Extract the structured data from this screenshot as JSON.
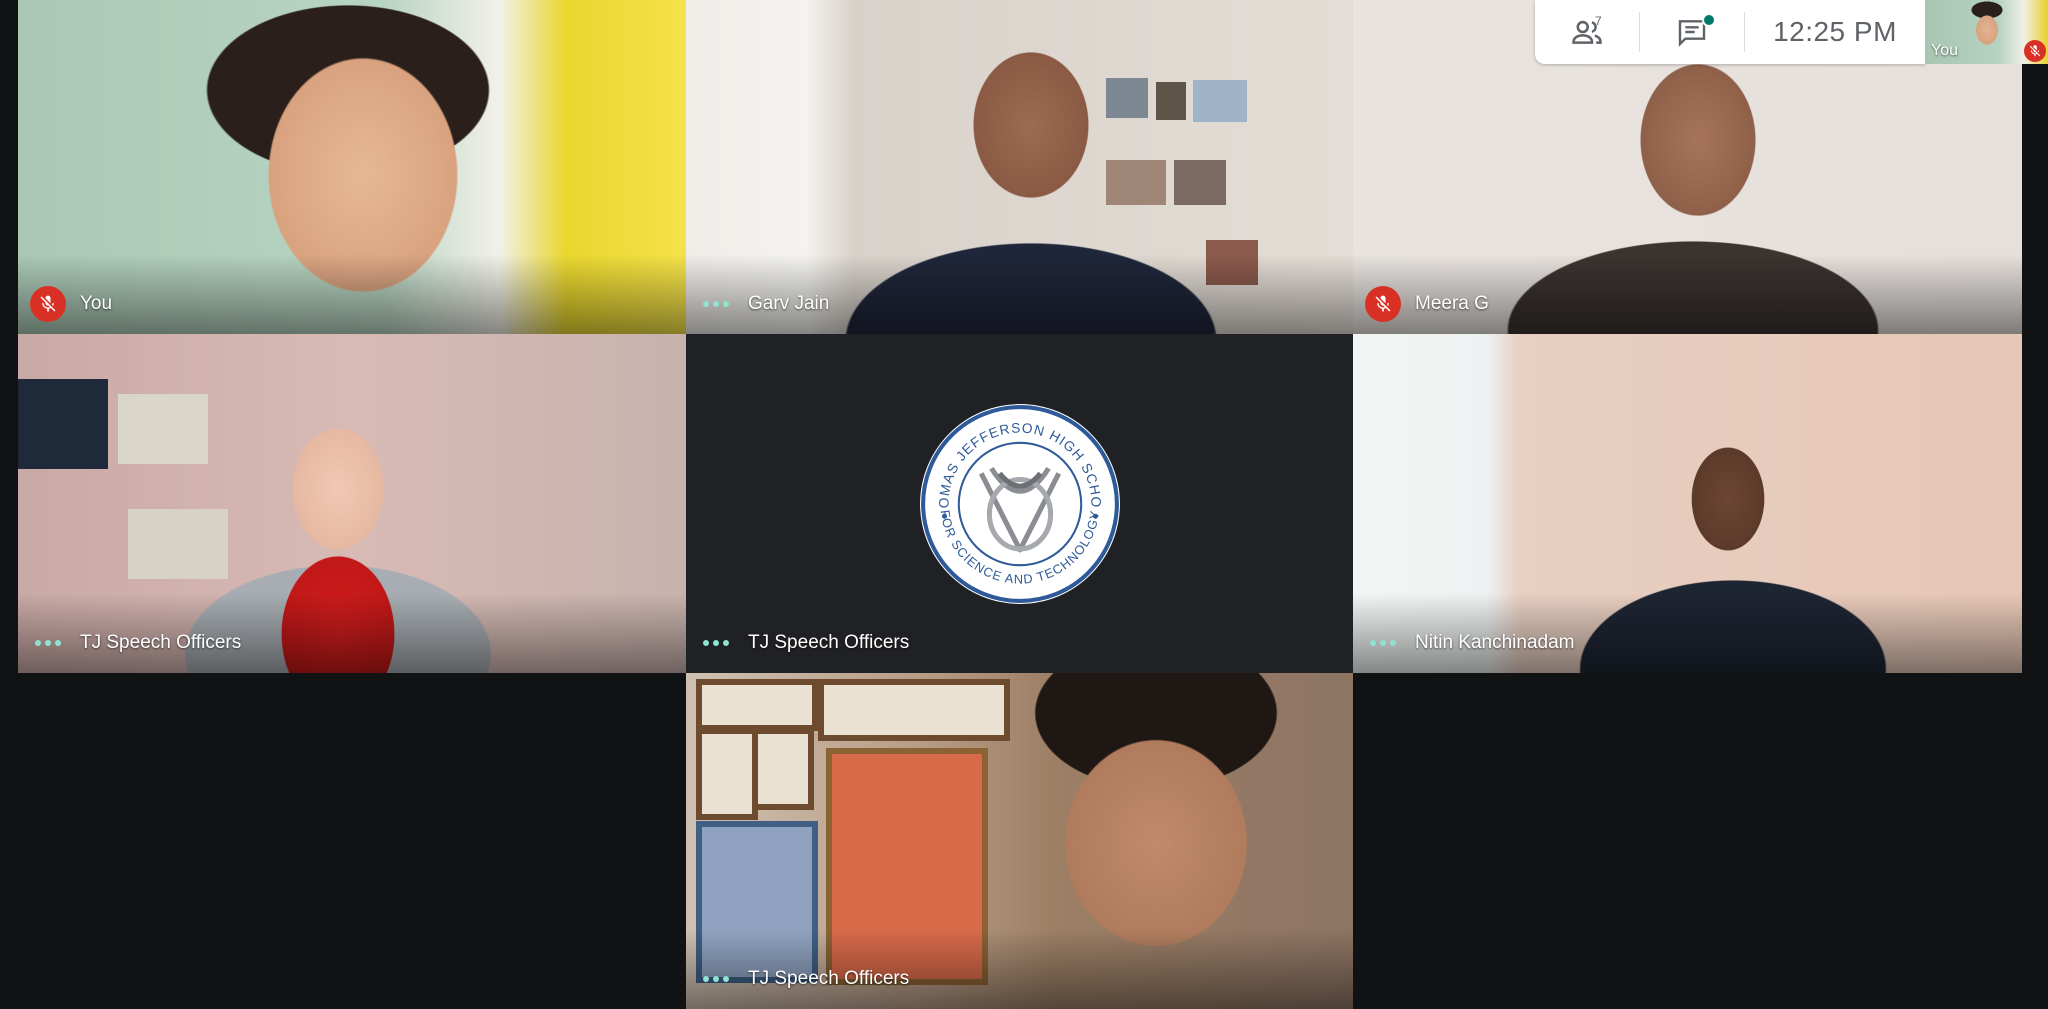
{
  "topbar": {
    "people_count": "7",
    "clock": "12:25 PM",
    "icons": {
      "people": "people-icon",
      "chat": "chat-icon"
    }
  },
  "self_view": {
    "label": "You",
    "muted": true
  },
  "tiles": [
    {
      "name": "You",
      "status": "muted"
    },
    {
      "name": "Garv Jain",
      "status": "active"
    },
    {
      "name": "Meera G",
      "status": "muted"
    },
    {
      "name": "TJ Speech Officers",
      "status": "active"
    },
    {
      "name": "TJ Speech Officers",
      "status": "active",
      "type": "logo"
    },
    {
      "name": "Nitin Kanchinadam",
      "status": "active"
    },
    {
      "name": "TJ Speech Officers",
      "status": "active"
    }
  ],
  "logo": {
    "top_text": "THOMAS JEFFERSON HIGH SCHOOL",
    "bottom_text": "FOR SCIENCE AND TECHNOLOGY"
  },
  "colors": {
    "mute_red": "#d93025",
    "activity_teal": "#8ee3d1",
    "background": "#111214",
    "logo_blue": "#2f5a99"
  }
}
